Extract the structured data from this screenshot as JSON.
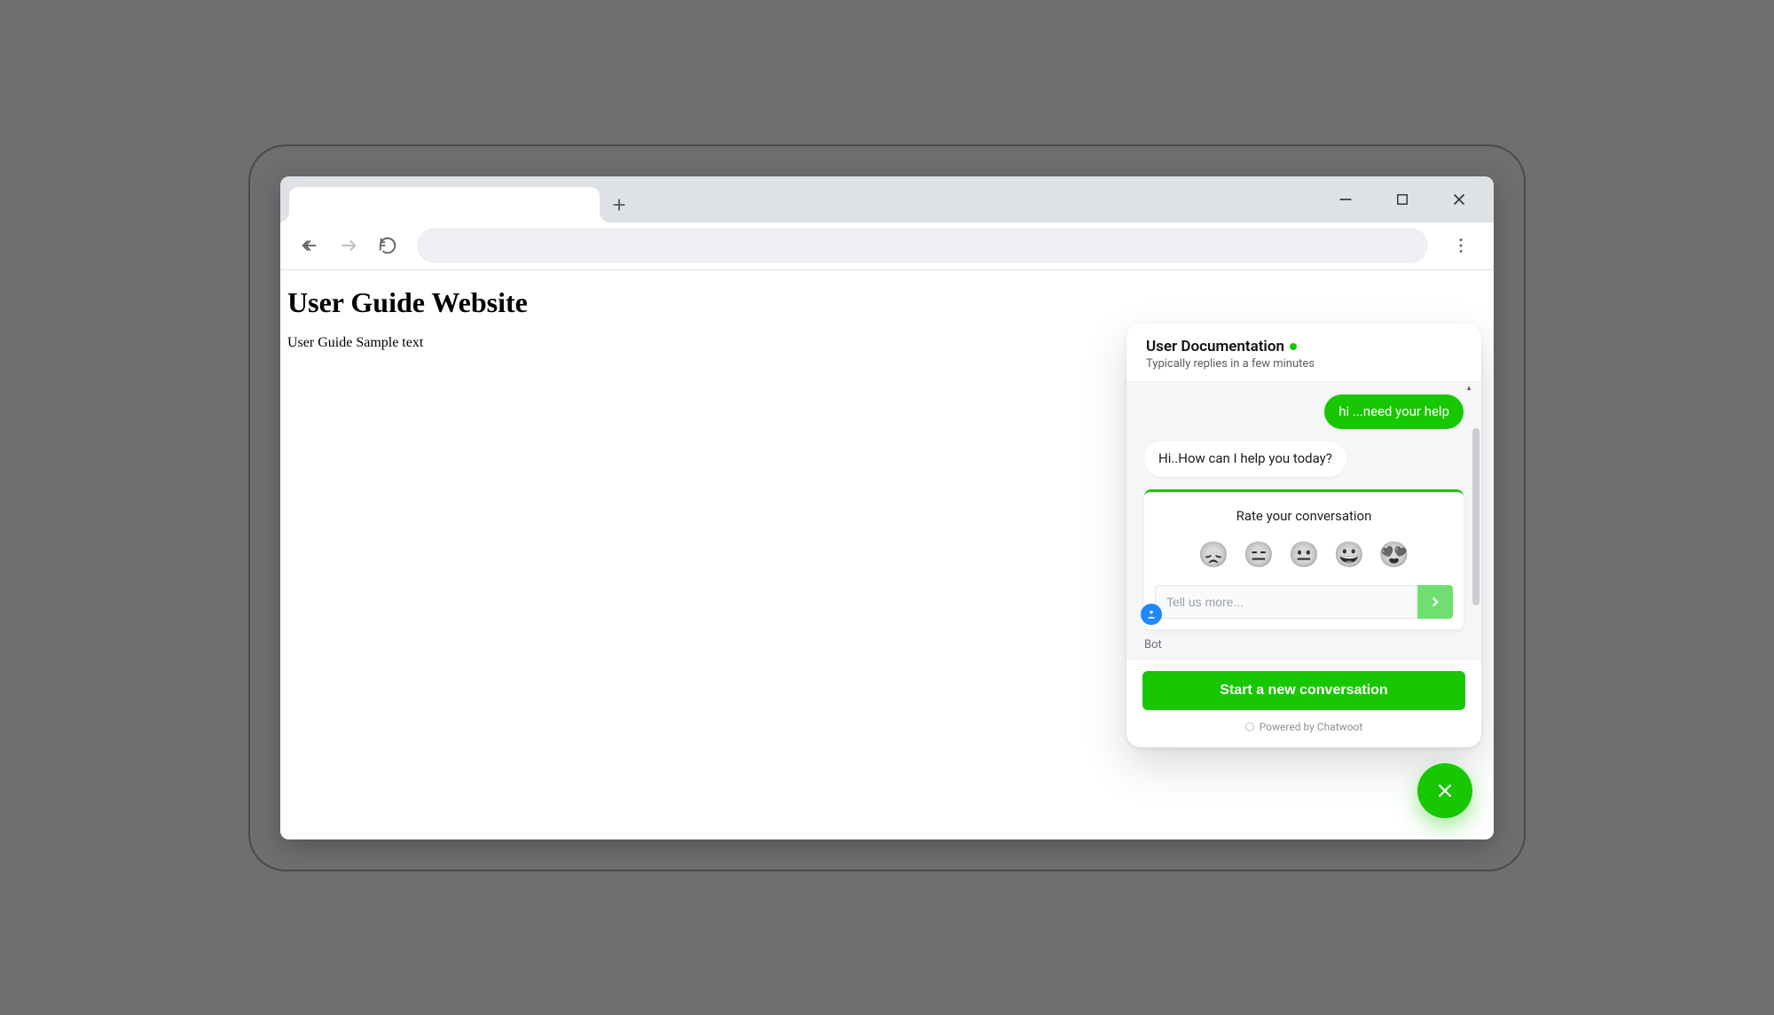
{
  "tab": {
    "title": ""
  },
  "page": {
    "heading": "User Guide Website",
    "body_text": "User Guide Sample text"
  },
  "chat": {
    "title": "User Documentation",
    "status_online": true,
    "subheader": "Typically replies in a few minutes",
    "messages": [
      {
        "from": "user",
        "text": "hi ...need your help"
      },
      {
        "from": "agent",
        "text": "Hi..How can I help you today?"
      }
    ],
    "csat": {
      "title": "Rate your conversation",
      "emojis": [
        "😞",
        "😑",
        "😐",
        "😀",
        "😍"
      ],
      "input_placeholder": "Tell us more..."
    },
    "bot_label": "Bot",
    "new_conversation_label": "Start a new conversation",
    "powered_by": "Powered by Chatwoot"
  }
}
